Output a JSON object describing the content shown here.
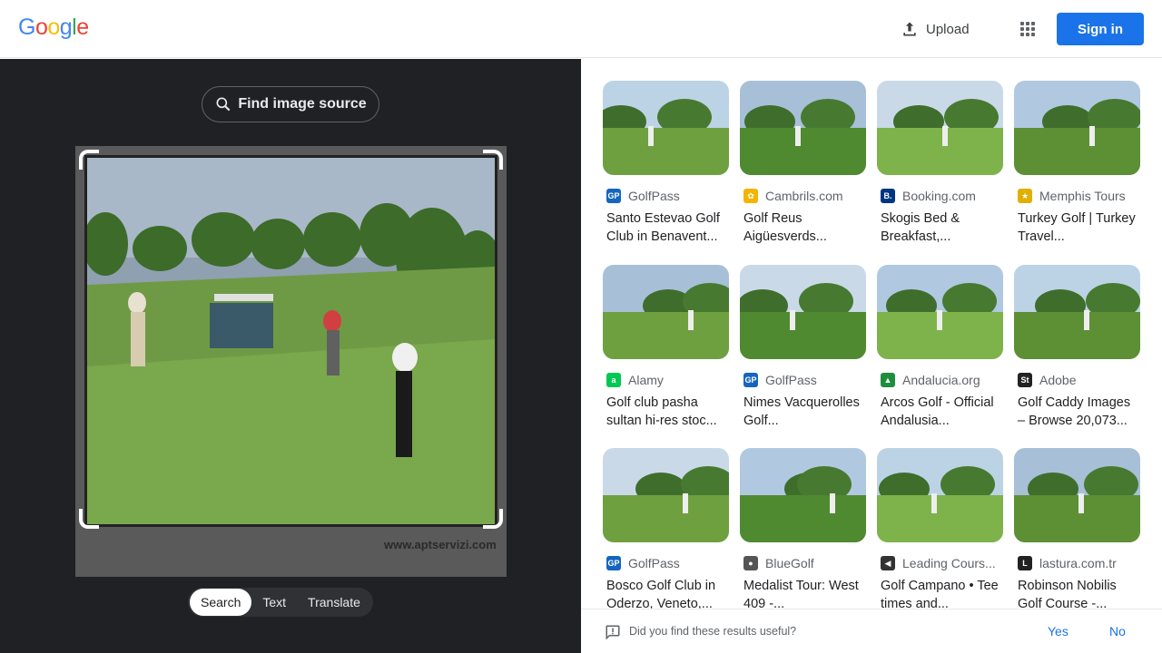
{
  "header": {
    "logo_letters": [
      "G",
      "o",
      "o",
      "g",
      "l",
      "e"
    ],
    "logo_colors": [
      "#4285f4",
      "#ea4335",
      "#fbbc05",
      "#4285f4",
      "#34a853",
      "#ea4335"
    ],
    "upload_label": "Upload",
    "signin_label": "Sign in"
  },
  "lens": {
    "find_source_label": "Find image source",
    "watermark": "www.aptservizi.com",
    "modes": [
      "Search",
      "Text",
      "Translate"
    ],
    "active_mode": "Search"
  },
  "results": [
    {
      "source": "GolfPass",
      "favicon": "GP",
      "favicon_color": "#1565c0",
      "title": "Santo Estevao Golf Club in Benavent..."
    },
    {
      "source": "Cambrils.com",
      "favicon": "✿",
      "favicon_color": "#f4b400",
      "title": "Golf Reus Aigüesverds..."
    },
    {
      "source": "Booking.com",
      "favicon": "B.",
      "favicon_color": "#003580",
      "title": "Skogis Bed & Breakfast,..."
    },
    {
      "source": "Memphis Tours",
      "favicon": "★",
      "favicon_color": "#e0b000",
      "title": "Turkey Golf | Turkey Travel..."
    },
    {
      "source": "Alamy",
      "favicon": "a",
      "favicon_color": "#00c853",
      "title": "Golf club pasha sultan hi-res stoc..."
    },
    {
      "source": "GolfPass",
      "favicon": "GP",
      "favicon_color": "#1565c0",
      "title": "Nimes Vacquerolles Golf..."
    },
    {
      "source": "Andalucia.org",
      "favicon": "▲",
      "favicon_color": "#1e8e3e",
      "title": "Arcos Golf - Official Andalusia..."
    },
    {
      "source": "Adobe",
      "favicon": "St",
      "favicon_color": "#222222",
      "title": "Golf Caddy Images – Browse 20,073..."
    },
    {
      "source": "GolfPass",
      "favicon": "GP",
      "favicon_color": "#1565c0",
      "title": "Bosco Golf Club in Oderzo, Veneto,..."
    },
    {
      "source": "BlueGolf",
      "favicon": "●",
      "favicon_color": "#555555",
      "title": "Medalist Tour: West 409 -..."
    },
    {
      "source": "Leading Cours...",
      "favicon": "◀",
      "favicon_color": "#333333",
      "title": "Golf Campano • Tee times and..."
    },
    {
      "source": "lastura.com.tr",
      "favicon": "L",
      "favicon_color": "#222222",
      "title": "Robinson Nobilis Golf Course -..."
    }
  ],
  "feedback": {
    "question": "Did you find these results useful?",
    "yes_label": "Yes",
    "no_label": "No"
  }
}
